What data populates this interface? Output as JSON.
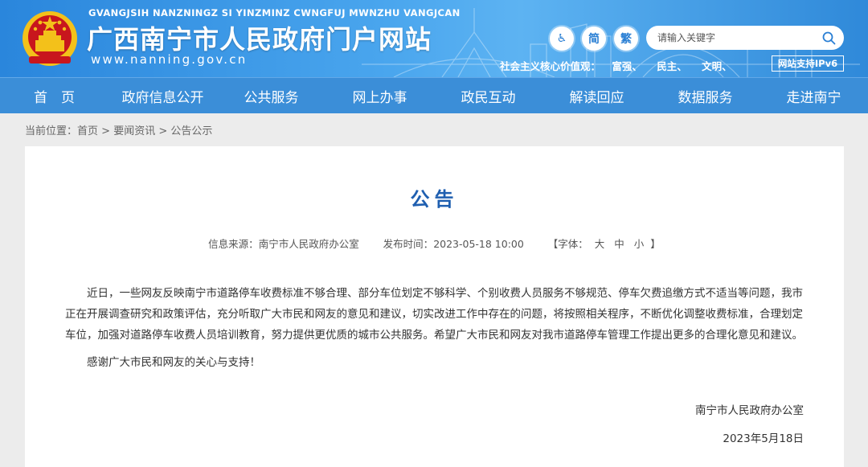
{
  "header": {
    "pinyin": "GVANGJSIH NANZNINGZ SI YINZMINZ CWNGFUJ MWNZHU VANGJCAN",
    "site_title": "广西南宁市人民政府门户网站",
    "domain": "www.nanning.gov.cn",
    "accessibility_label": "♿",
    "simplified_label": "简",
    "traditional_label": "繁",
    "search_placeholder": "请输入关键字",
    "values_label": "社会主义核心价值观：",
    "values": [
      "富强、",
      "民主、",
      "文明、"
    ],
    "ipv6_label": "网站支持IPv6"
  },
  "nav": {
    "items": [
      "首　页",
      "政府信息公开",
      "公共服务",
      "网上办事",
      "政民互动",
      "解读回应",
      "数据服务",
      "走进南宁"
    ]
  },
  "breadcrumb": {
    "label": "当前位置：",
    "items": [
      "首页",
      "要闻资讯",
      "公告公示"
    ],
    "separator": " > "
  },
  "article": {
    "title": "公告",
    "source_label": "信息来源：",
    "source": "南宁市人民政府办公室",
    "time_label": "发布时间：",
    "time": "2023-05-18 10:00",
    "font_label": "【字体：",
    "font_large": "大",
    "font_medium": "中",
    "font_small": "小",
    "font_close": "】",
    "paragraph1": "近日，一些网友反映南宁市道路停车收费标准不够合理、部分车位划定不够科学、个别收费人员服务不够规范、停车欠费追缴方式不适当等问题，我市正在开展调查研究和政策评估，充分听取广大市民和网友的意见和建议，切实改进工作中存在的问题，将按照相关程序，不断优化调整收费标准，合理划定车位，加强对道路停车收费人员培训教育，努力提供更优质的城市公共服务。希望广大市民和网友对我市道路停车管理工作提出更多的合理化意见和建议。",
    "paragraph2": "感谢广大市民和网友的关心与支持！",
    "signature": "南宁市人民政府办公室",
    "date": "2023年5月18日"
  },
  "colors": {
    "header_blue": "#2a86dc",
    "nav_blue": "#3b8ed8",
    "title_blue": "#1f5fb0",
    "emblem_red": "#c8161d",
    "emblem_gold": "#f3c11a"
  }
}
